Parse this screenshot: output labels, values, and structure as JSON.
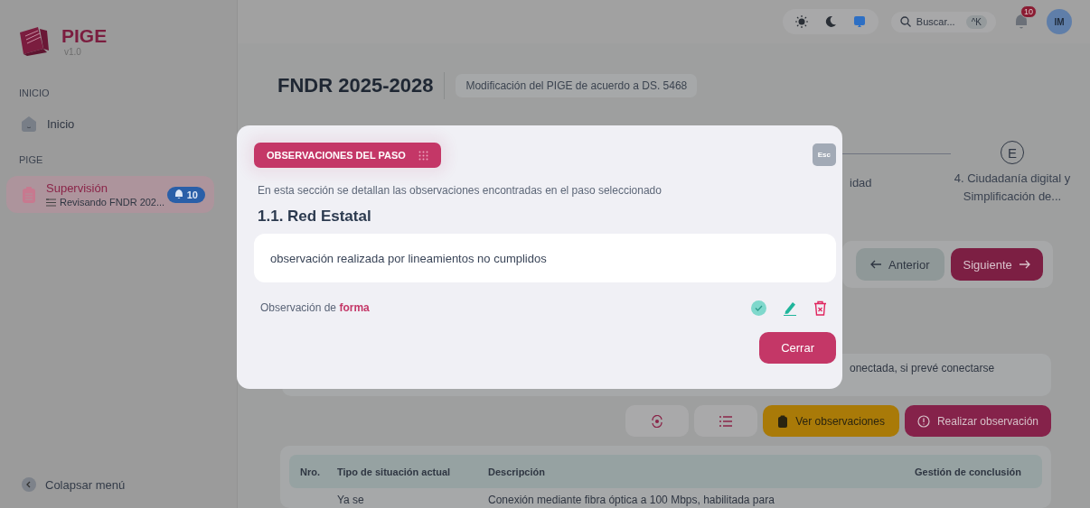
{
  "sidebar": {
    "logo": {
      "name": "PIGE",
      "version": "v1.0"
    },
    "sections": [
      {
        "heading": "INICIO",
        "items": [
          {
            "label": "Inicio",
            "selected": false
          }
        ]
      },
      {
        "heading": "PIGE",
        "items": [
          {
            "label": "Supervisión",
            "subtitle": "Revisando FNDR 202...",
            "badge": "10",
            "selected": true
          }
        ]
      }
    ],
    "collapse": "Colapsar menú"
  },
  "topbar": {
    "theme_modes": [
      {
        "kind": "light",
        "selected": false
      },
      {
        "kind": "dark",
        "selected": false
      },
      {
        "kind": "system",
        "selected": true
      }
    ],
    "search": {
      "placeholder": "Buscar...",
      "shortcut": "^K"
    },
    "notifications": "10",
    "avatar": "IM"
  },
  "header": {
    "title": "FNDR 2025-2028",
    "tag": "Modificación del PIGE de acuerdo a DS. 5468"
  },
  "stepper": {
    "partial_label": "idad",
    "step": {
      "marker": "E",
      "label": "4. Ciudadanía digital y Simplificación de..."
    }
  },
  "navigation": {
    "previous": "Anterior",
    "next": "Siguiente"
  },
  "step_text": "onectada, si prevé conectarse",
  "actions": [
    {
      "kind": "warning",
      "label": "Ver observaciones"
    },
    {
      "kind": "primary",
      "label": "Realizar observación"
    }
  ],
  "table": {
    "columns": [
      "Nro.",
      "Tipo de situación actual",
      "Descripción",
      "Gestión de conclusión"
    ],
    "rows": [
      {
        "situation": "Ya se",
        "description": "Conexión mediante fibra óptica a 100 Mbps, habilitada para"
      }
    ]
  },
  "modal": {
    "title": "OBSERVACIONES DEL PASO",
    "close_key": "Esc",
    "intro": "En esta sección se detallan las observaciones encontradas en el paso seleccionado",
    "step_title": "1.1. Red Estatal",
    "observations": [
      {
        "text": "observación realizada por lineamientos no cumplidos",
        "category": "Observación de **forma**"
      }
    ],
    "close_button": "Cerrar"
  }
}
